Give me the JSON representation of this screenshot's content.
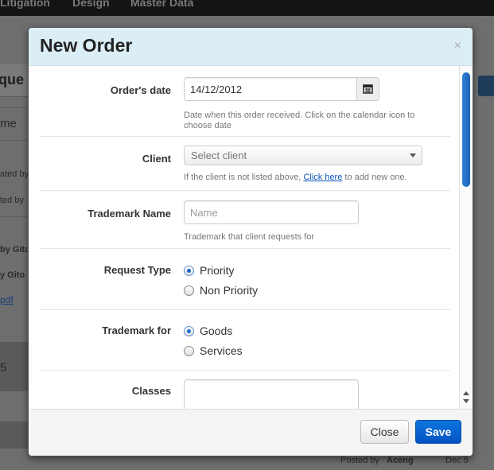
{
  "background": {
    "nav_items": [
      "Litigation",
      "Design",
      "Master Data"
    ],
    "page_title_fragment": "que",
    "snippets": [
      "me",
      "ated by",
      "ted by",
      "by Gito",
      "y Gito",
      "pdf",
      "5"
    ],
    "footer": {
      "posted_by_label": "Posted by",
      "posted_by_name": "Aceng",
      "date": "Dec 5"
    }
  },
  "modal": {
    "title": "New Order",
    "close_symbol": "×",
    "fields": {
      "order_date": {
        "label": "Order's date",
        "value": "14/12/2012",
        "help": "Date when this order received. Click on the calendar icon to choose date"
      },
      "client": {
        "label": "Client",
        "placeholder": "Select client",
        "help_prefix": "If the client is not listed above,",
        "help_link": "Click here",
        "help_suffix": "to add new one."
      },
      "trademark_name": {
        "label": "Trademark Name",
        "placeholder": "Name",
        "help": "Trademark that client requests for"
      },
      "request_type": {
        "label": "Request Type",
        "options": [
          "Priority",
          "Non Priority"
        ],
        "selected": "Priority"
      },
      "trademark_for": {
        "label": "Trademark for",
        "options": [
          "Goods",
          "Services"
        ],
        "selected": "Goods"
      },
      "classes": {
        "label": "Classes"
      }
    },
    "buttons": {
      "close": "Close",
      "save": "Save"
    }
  },
  "colors": {
    "accent": "#0552c2",
    "header_bg": "#dbeef6",
    "link": "#0a55b8"
  }
}
